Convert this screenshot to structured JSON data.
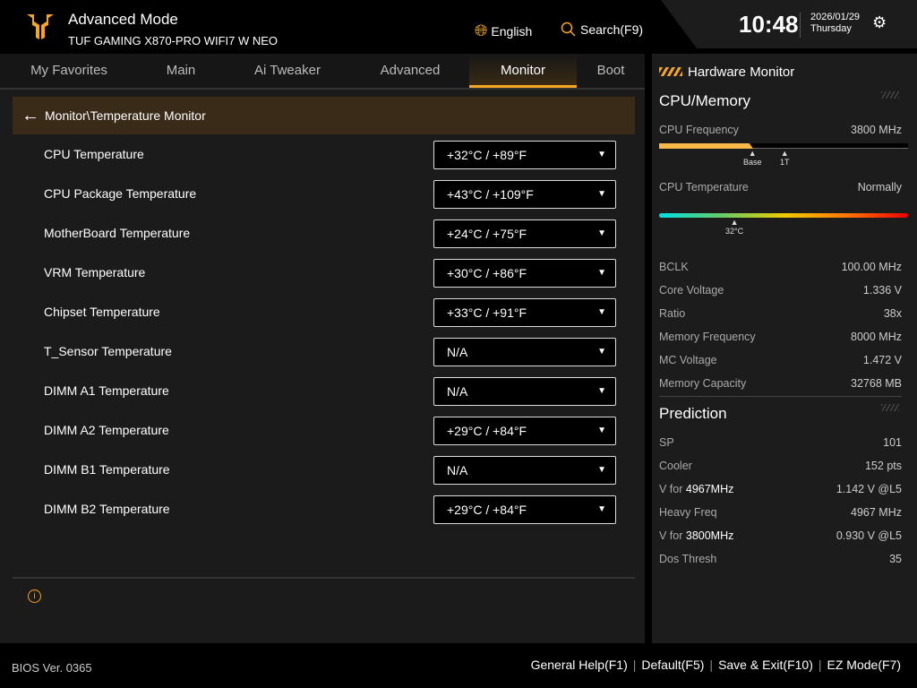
{
  "header": {
    "title": "Advanced Mode",
    "model": "TUF GAMING X870-PRO WIFI7 W NEO",
    "language": "English",
    "search": "Search(F9)",
    "time": "10:48",
    "date": "2026/01/29",
    "day": "Thursday"
  },
  "tabs": [
    {
      "label": "My Favorites"
    },
    {
      "label": "Main"
    },
    {
      "label": "Ai Tweaker"
    },
    {
      "label": "Advanced"
    },
    {
      "label": "Monitor",
      "active": true
    },
    {
      "label": "Boot"
    }
  ],
  "breadcrumb": "Monitor\\Temperature Monitor",
  "rows": [
    {
      "label": "CPU Temperature",
      "value": "+32°C / +89°F"
    },
    {
      "label": "CPU Package Temperature",
      "value": "+43°C / +109°F"
    },
    {
      "label": "MotherBoard Temperature",
      "value": "+24°C / +75°F"
    },
    {
      "label": "VRM Temperature",
      "value": "+30°C / +86°F"
    },
    {
      "label": "Chipset Temperature",
      "value": "+33°C / +91°F"
    },
    {
      "label": "T_Sensor Temperature",
      "value": "N/A"
    },
    {
      "label": "DIMM A1 Temperature",
      "value": "N/A"
    },
    {
      "label": "DIMM A2 Temperature",
      "value": "+29°C / +84°F"
    },
    {
      "label": "DIMM B1 Temperature",
      "value": "N/A"
    },
    {
      "label": "DIMM B2 Temperature",
      "value": "+29°C / +84°F"
    }
  ],
  "hw": {
    "title": "Hardware Monitor",
    "cpu_section": "CPU/Memory",
    "cpu_freq_label": "CPU Frequency",
    "cpu_freq": "3800 MHz",
    "freq_ticks": [
      "Base",
      "1T"
    ],
    "cpu_temp_label": "CPU Temperature",
    "cpu_temp_status": "Normally",
    "temp_marker": "32°C",
    "items": [
      {
        "k": "BCLK",
        "v": "100.00 MHz"
      },
      {
        "k": "Core Voltage",
        "v": "1.336 V"
      },
      {
        "k": "Ratio",
        "v": "38x"
      },
      {
        "k": "Memory Frequency",
        "v": "8000 MHz"
      },
      {
        "k": "MC Voltage",
        "v": "1.472 V"
      },
      {
        "k": "Memory Capacity",
        "v": "32768 MB"
      }
    ],
    "prediction_section": "Prediction",
    "prediction": [
      {
        "k": "SP",
        "v": "101"
      },
      {
        "k": "Cooler",
        "v": "152 pts"
      },
      {
        "k": "V for ",
        "k2": "4967MHz",
        "v": "1.142 V @L5"
      },
      {
        "k": "Heavy Freq",
        "v": "4967 MHz"
      },
      {
        "k": "V for ",
        "k2": "3800MHz",
        "v": "0.930 V @L5"
      },
      {
        "k": "Dos Thresh",
        "v": "35"
      }
    ]
  },
  "footer": {
    "bios": "BIOS Ver. 0365",
    "keys": [
      "General Help(F1)",
      "Default(F5)",
      "Save & Exit(F10)",
      "EZ Mode(F7)"
    ]
  },
  "colors": {
    "accent": "#f5a623",
    "breadcrumb_bg": "#3a2a18"
  }
}
